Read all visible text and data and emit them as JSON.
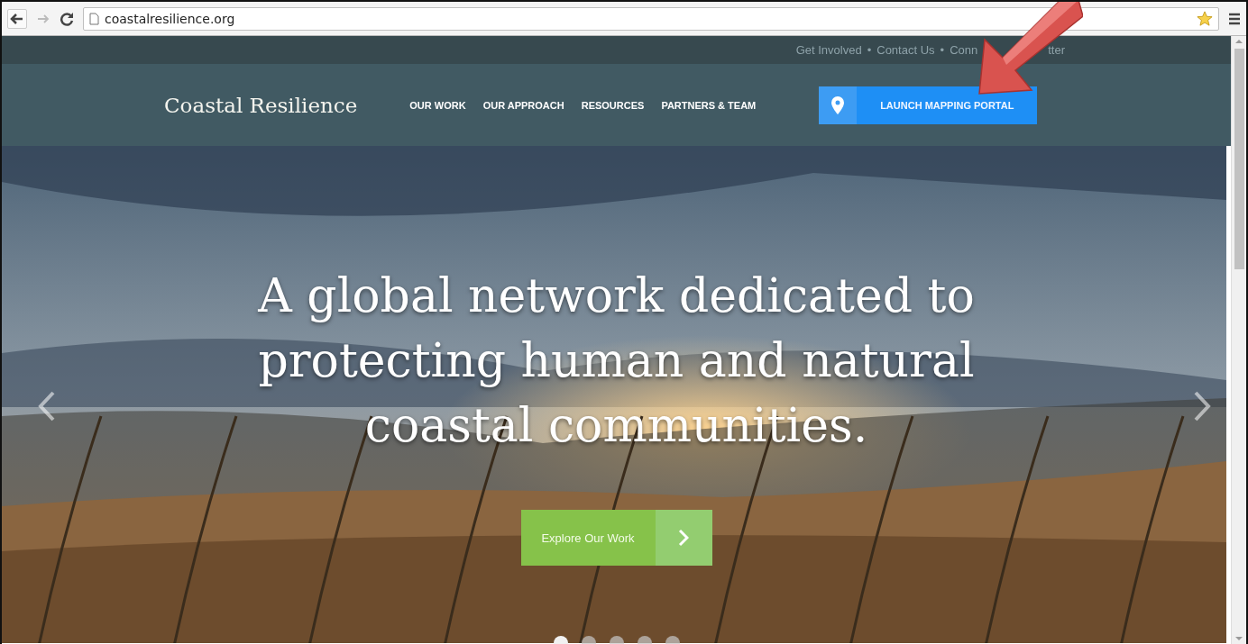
{
  "browser": {
    "url": "coastalresilience.org"
  },
  "utility_bar": {
    "separator": "•",
    "links": [
      {
        "label": "Get Involved"
      },
      {
        "label": "Contact Us"
      },
      {
        "label": "Conn",
        "end": "tter"
      }
    ]
  },
  "header": {
    "logo": "Coastal Resilience",
    "nav": [
      "OUR WORK",
      "OUR APPROACH",
      "RESOURCES",
      "PARTNERS & TEAM"
    ],
    "cta": "LAUNCH MAPPING PORTAL"
  },
  "hero": {
    "heading": "A global network dedicated to protecting human and natural coastal communities.",
    "button": "Explore Our Work",
    "slides": [
      {
        "selected": true
      },
      {
        "selected": false
      },
      {
        "selected": false
      },
      {
        "selected": false
      },
      {
        "selected": false
      }
    ]
  }
}
